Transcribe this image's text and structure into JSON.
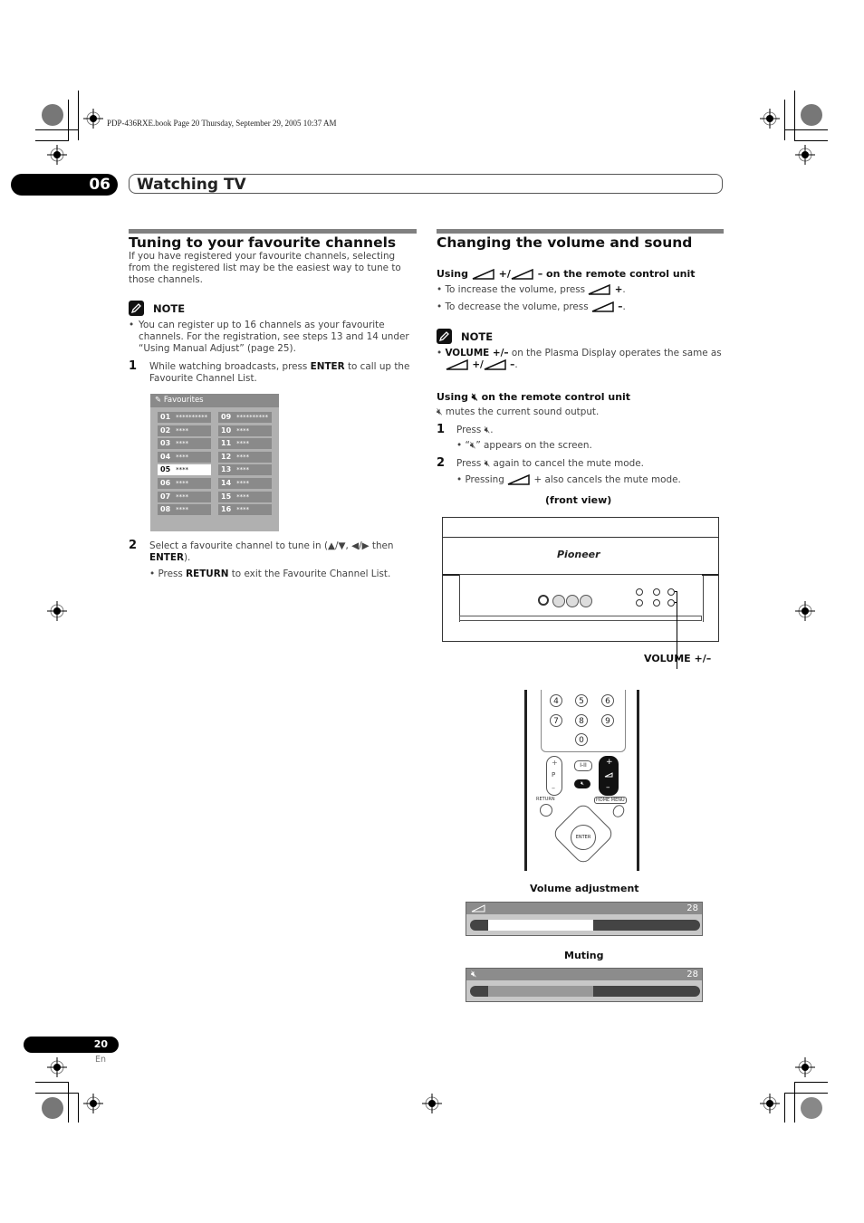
{
  "print_header": "PDP-436RXE.book  Page 20  Thursday, September 29, 2005  10:37 AM",
  "chapter": {
    "number": "06",
    "title": "Watching TV"
  },
  "left": {
    "title": "Tuning to your favourite channels",
    "intro": "If you have registered your favourite channels, selecting from the registered list may be the easiest way to tune to those channels.",
    "note_label": "NOTE",
    "note_text": "You can register up to 16 channels as your favourite channels. For the registration, see steps 13 and 14 under “Using Manual Adjust” (page 25).",
    "step1_num": "1",
    "step1_pre": "While watching broadcasts, press ",
    "step1_bold": "ENTER",
    "step1_post": " to call up the Favourite Channel List.",
    "favourites": {
      "title": "Favourites",
      "selected": "05",
      "channels": [
        {
          "num": "01",
          "name": "**********"
        },
        {
          "num": "02",
          "name": "****"
        },
        {
          "num": "03",
          "name": "****"
        },
        {
          "num": "04",
          "name": "****"
        },
        {
          "num": "05",
          "name": "****"
        },
        {
          "num": "06",
          "name": "****"
        },
        {
          "num": "07",
          "name": "****"
        },
        {
          "num": "08",
          "name": "****"
        },
        {
          "num": "09",
          "name": "**********"
        },
        {
          "num": "10",
          "name": "****"
        },
        {
          "num": "11",
          "name": "****"
        },
        {
          "num": "12",
          "name": "****"
        },
        {
          "num": "13",
          "name": "****"
        },
        {
          "num": "14",
          "name": "****"
        },
        {
          "num": "15",
          "name": "****"
        },
        {
          "num": "16",
          "name": "****"
        }
      ]
    },
    "step2_num": "2",
    "step2_pre": "Select a favourite channel to tune in (▲/▼, ◀/▶ then ",
    "step2_bold": "ENTER",
    "step2_post": ").",
    "step2_bullet_pre": "Press ",
    "step2_bullet_bold": "RETURN",
    "step2_bullet_post": " to exit the Favourite Channel List."
  },
  "right": {
    "title": "Changing the volume and sound",
    "sub1_pre": "Using ",
    "sub1_mid": " +/",
    "sub1_post": " – on the remote control unit",
    "bullet_inc": "To increase the volume, press ",
    "bullet_dec": "To decrease the volume, press ",
    "plus": "+",
    "minus": "–",
    "note_label": "NOTE",
    "note_bold": "VOLUME +/–",
    "note_text": " on the Plasma Display operates the same as",
    "sub2_pre": "Using ",
    "sub2_post": " on the remote control unit",
    "mute_desc": " mutes the current sound output.",
    "m_step1_num": "1",
    "m_step1": "Press ",
    "m_step1_bullet": "“",
    "m_step1_bullet_post": "” appears on the screen.",
    "m_step2_num": "2",
    "m_step2_pre": "Press ",
    "m_step2_post": " again to cancel the mute mode.",
    "m_step2_bullet_pre": "Pressing ",
    "m_step2_bullet_post": " + also cancels the mute mode.",
    "front_view_label": "(front view)",
    "brand": "Pioneer",
    "volume_callout": "VOLUME +/–",
    "remote": {
      "digits": [
        "4",
        "5",
        "6",
        "7",
        "8",
        "9",
        "0"
      ],
      "i_ii": "I-II",
      "p_label": "P",
      "return_label": "RETURN",
      "home_menu_label": "HOME MENU",
      "enter_label": "ENTER"
    },
    "volume_adjustment_label": "Volume adjustment",
    "muting_label": "Muting",
    "osd_volume": {
      "value": "28",
      "level_fraction": 0.45
    },
    "osd_mute": {
      "value": "28",
      "level_fraction": 0.45
    }
  },
  "footer": {
    "page_number": "20",
    "lang": "En"
  }
}
